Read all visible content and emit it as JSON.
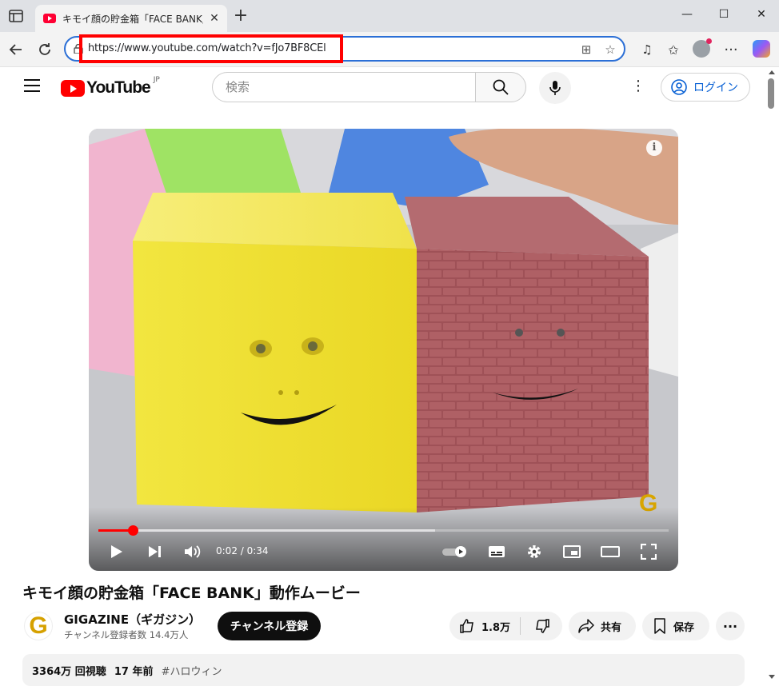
{
  "browser": {
    "tab_title": "キモイ顔の貯金箱「FACE BANK」動作ムービー",
    "url": "https://www.youtube.com/watch?v=fJo7BF8CEl"
  },
  "youtube": {
    "region": "JP",
    "search_placeholder": "検索",
    "login_label": "ログイン"
  },
  "player": {
    "time": "0:02 / 0:34",
    "progress_played": 0.06,
    "progress_loaded": 0.59
  },
  "video": {
    "title": "キモイ顔の貯金箱「FACE BANK」動作ムービー",
    "channel_name": "GIGAZINE（ギガジン）",
    "subscribers": "チャンネル登録者数 14.4万人",
    "subscribe_label": "チャンネル登録",
    "likes": "1.8万",
    "share_label": "共有",
    "save_label": "保存",
    "views": "3364万 回視聴",
    "age": "17 年前",
    "hashtag": "#ハロウィン"
  },
  "colors": {
    "accent": "#ff0000",
    "link": "#065fd4"
  }
}
